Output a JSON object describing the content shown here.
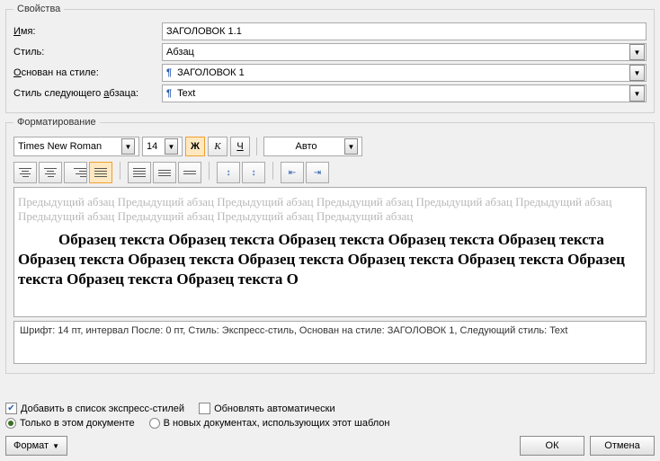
{
  "sections": {
    "properties": "Свойства",
    "formatting": "Форматирование"
  },
  "labels": {
    "name": "Имя:",
    "name_u": "И",
    "style": "Стиль:",
    "based_on": "Основан на стиле:",
    "based_on_u": "О",
    "next_style": "Стиль следующего абзаца:",
    "next_style_u": "а"
  },
  "values": {
    "name": "ЗАГОЛОВОК 1.1",
    "style": "Абзац",
    "based_on": "ЗАГОЛОВОК 1",
    "next_style": "Text"
  },
  "formatting": {
    "font": "Times New Roman",
    "size": "14",
    "bold": "Ж",
    "italic": "К",
    "underline": "Ч",
    "color": "Авто"
  },
  "preview": {
    "prev_para": "Предыдущий абзац Предыдущий абзац Предыдущий абзац Предыдущий абзац Предыдущий абзац Предыдущий абзац Предыдущий абзац Предыдущий абзац Предыдущий абзац Предыдущий абзац",
    "sample": "Образец текста Образец текста Образец текста Образец текста Образец текста Образец текста Образец текста Образец текста Образец текста Образец текста Образец текста Образец текста Образец текста О"
  },
  "description": "Шрифт: 14 пт, интервал После:  0 пт, Стиль: Экспресс-стиль, Основан на стиле: ЗАГОЛОВОК 1, Следующий стиль: Text",
  "options": {
    "add_quick": "Добавить в список экспресс-стилей",
    "add_quick_u": "э",
    "auto_update": "Обновлять автоматически",
    "auto_update_u": "О",
    "this_doc": "Только в этом документе",
    "this_doc_u": "э",
    "in_template": "В новых документах, использующих этот шаблон"
  },
  "buttons": {
    "format": "Формат",
    "format_u": "Ф",
    "ok": "ОК",
    "cancel": "Отмена"
  }
}
